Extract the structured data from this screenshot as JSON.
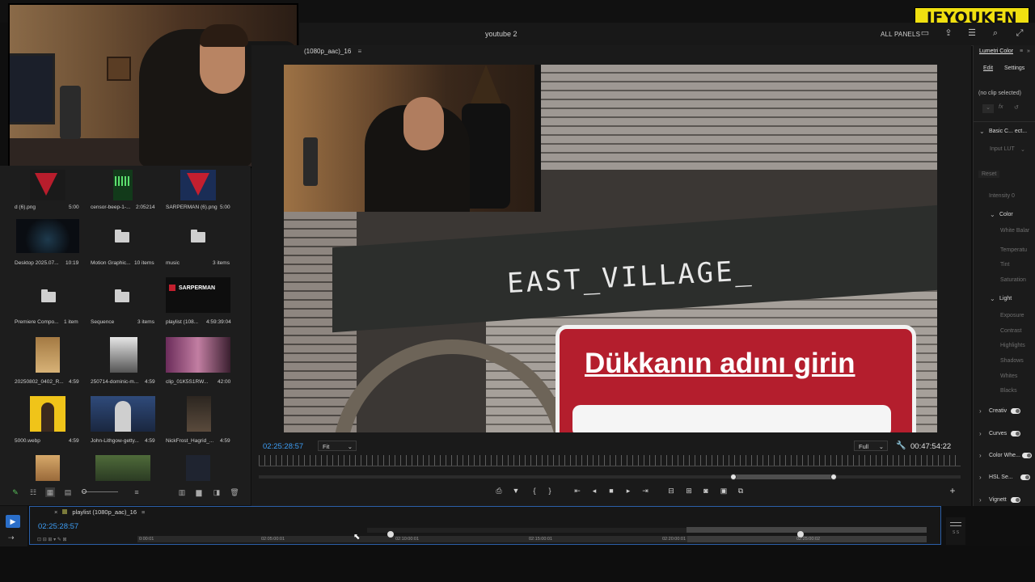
{
  "branding": {
    "logo_text": "IFYOUKEN"
  },
  "header": {
    "title": "youtube 2",
    "panels_label": "ALL PANELS"
  },
  "project": {
    "items": [
      {
        "name": "d (6).png",
        "duration": "5:00",
        "kind": "image-red"
      },
      {
        "name": "censor-beep-1-...",
        "duration": "2:05214",
        "kind": "audio"
      },
      {
        "name": "SARPERMAN (6).png",
        "duration": "5:00",
        "kind": "image-red"
      },
      {
        "name": "Desktop 2025.07...",
        "duration": "10:19",
        "kind": "video-dark"
      },
      {
        "name": "Motion Graphic...",
        "duration": "10 items",
        "kind": "folder"
      },
      {
        "name": "music",
        "duration": "3 items",
        "kind": "folder"
      },
      {
        "name": "Premiere Compo...",
        "duration": "1 item",
        "kind": "folder"
      },
      {
        "name": "Sequence",
        "duration": "3 items",
        "kind": "folder"
      },
      {
        "name": "playlist (108...",
        "duration": "4:59:39:04",
        "kind": "sequence"
      },
      {
        "name": "20250802_0402_R...",
        "duration": "4:59",
        "kind": "image"
      },
      {
        "name": "250714-dominic-m...",
        "duration": "4:59",
        "kind": "image"
      },
      {
        "name": "clip_01K5S1RW...",
        "duration": "42:00",
        "kind": "video"
      },
      {
        "name": "5000.webp",
        "duration": "4:59",
        "kind": "image"
      },
      {
        "name": "John-Lithgow-getty...",
        "duration": "4:59",
        "kind": "image"
      },
      {
        "name": "NickFrost_Hagrid_...",
        "duration": "4:59",
        "kind": "image"
      }
    ],
    "thumb_overlay_text": "SARPERMAN"
  },
  "program": {
    "tab_label": "(1080p_aac)_16",
    "playhead_tc": "02:25:28:57",
    "duration_tc": "00:47:54:22",
    "fit_label": "Fit",
    "quality_label": "Full",
    "scene_sign_text": "EAST_VILLAGE_",
    "overlay_text": "Dükkanın adını girin"
  },
  "lumetri": {
    "title": "Lumetri Color",
    "tabs": [
      "Edit",
      "Settings"
    ],
    "no_clip": "(no clip selected)",
    "basic_correction": "Basic C... ect...",
    "input_lut": "Input LUT",
    "reset": "Reset",
    "intensity": "Intensity 0",
    "color_section": "Color",
    "white_balance": "White Balar",
    "temperature": "Temperatu",
    "tint": "Tint",
    "saturation": "Saturation",
    "light_section": "Light",
    "exposure": "Exposure",
    "contrast": "Contrast",
    "highlights": "Highlights",
    "shadows": "Shadows",
    "whites": "Whites",
    "blacks": "Blacks",
    "creative": "Creativ",
    "curves": "Curves",
    "color_wheels": "Color Whe...",
    "hsl": "HSL Se...",
    "vignette": "Vignett"
  },
  "timeline": {
    "sequence_name": "playlist (1080p_aac)_16",
    "playhead_tc": "02:25:28:57",
    "ruler_labels": [
      "0:00:01",
      "02:05:00:01",
      "02:10:00:01",
      "02:15:00:01",
      "02:20:00:01",
      "02:25:00:02"
    ]
  },
  "colors": {
    "accent_blue": "#3d9df4",
    "logo_yellow": "#f0e010",
    "overlay_red": "#b41e2d"
  }
}
